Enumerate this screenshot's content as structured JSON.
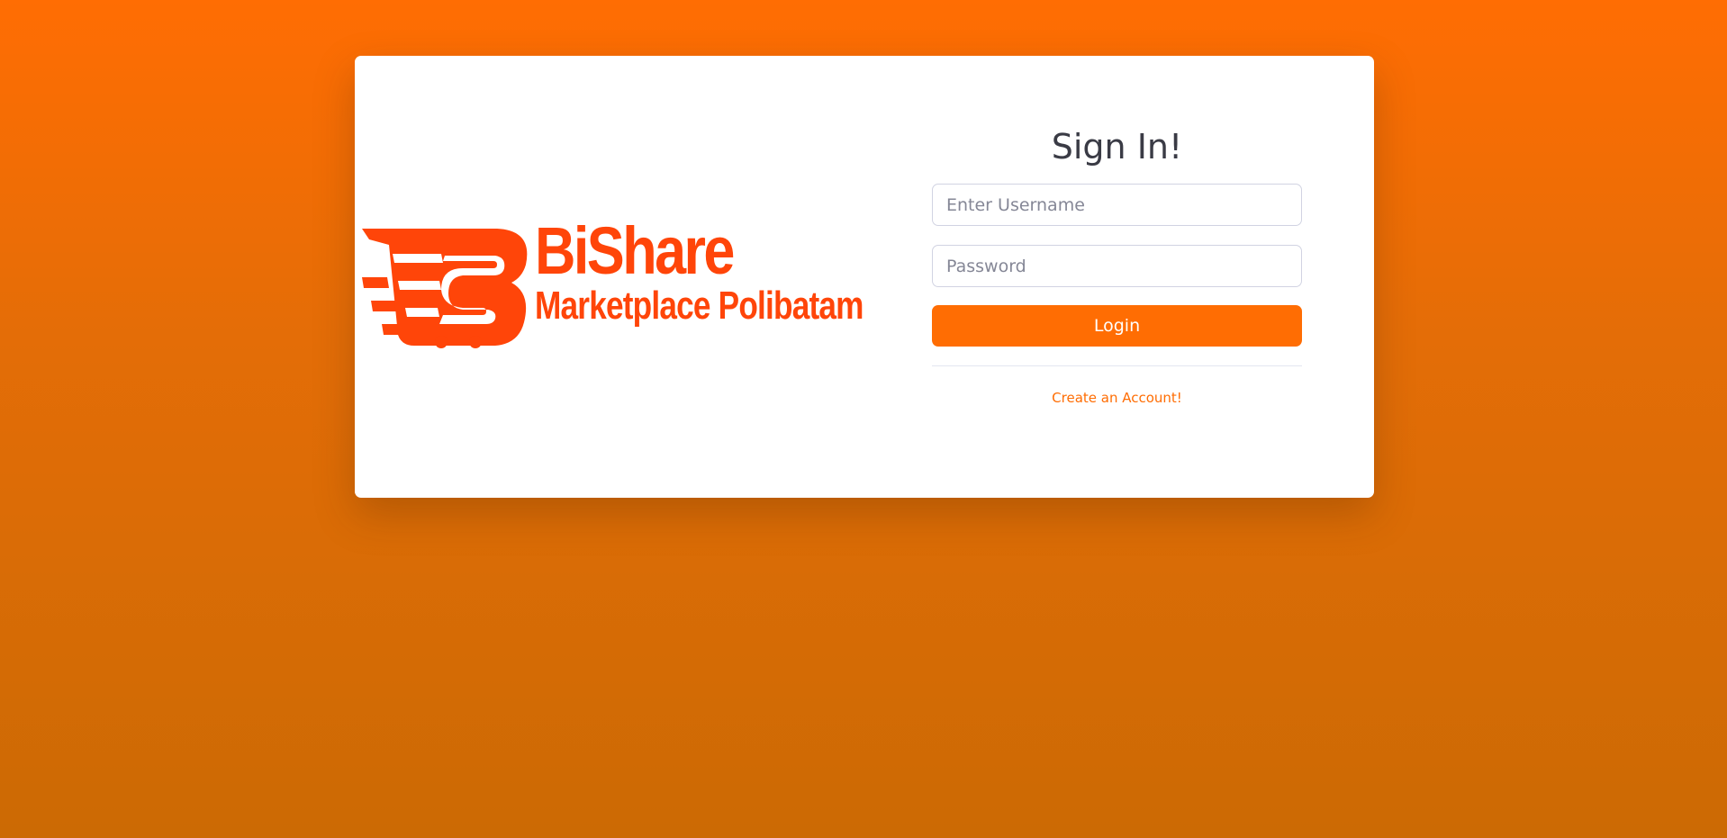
{
  "logo": {
    "icon": "shopping-cart-s-icon",
    "brand_name": "BiShare",
    "tagline": "Marketplace Polibatam",
    "color": "#FF4509"
  },
  "form": {
    "title": "Sign In!",
    "username_placeholder": "Enter Username",
    "username_value": "",
    "password_placeholder": "Password",
    "password_value": "",
    "login_label": "Login",
    "create_account_label": "Create an Account!"
  },
  "colors": {
    "accent": "#FF6D03",
    "background_top": "#FF6D03",
    "background_bottom": "#CC6A04",
    "card": "#FFFFFF",
    "title_text": "#3A3B45"
  }
}
